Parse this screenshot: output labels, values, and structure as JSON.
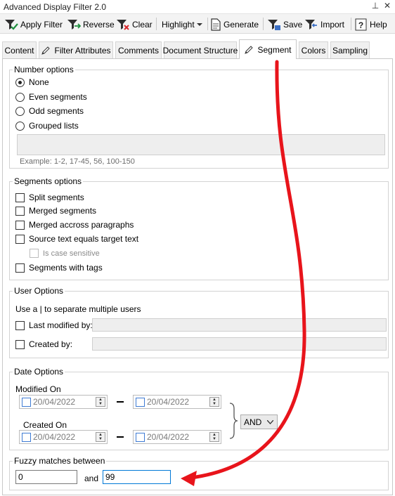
{
  "window": {
    "title": "Advanced Display Filter 2.0",
    "pin_glyph": "⊥",
    "close_glyph": "✕"
  },
  "toolbar": {
    "apply_filter": "Apply Filter",
    "reverse": "Reverse",
    "clear": "Clear",
    "highlight": "Highlight",
    "generate": "Generate",
    "save": "Save",
    "import": "Import",
    "help": "Help"
  },
  "tabs": [
    "Content",
    "Filter Attributes",
    "Comments",
    "Document Structure",
    "Segment",
    "Colors",
    "Sampling"
  ],
  "number_options": {
    "title": "Number options",
    "options": [
      "None",
      "Even segments",
      "Odd segments",
      "Grouped lists"
    ],
    "selected": "None",
    "example": "Example: 1-2, 17-45, 56, 100-150"
  },
  "segments_options": {
    "title": "Segments options",
    "items": [
      "Split segments",
      "Merged segments",
      "Merged accross paragraphs",
      "Source text equals target text",
      "Is case sensitive",
      "Segments with tags"
    ]
  },
  "user_options": {
    "title": "User Options",
    "hint": "Use a | to separate multiple users",
    "last_modified_by": "Last modified by:",
    "created_by": "Created by:"
  },
  "date_options": {
    "title": "Date Options",
    "modified_on": "Modified On",
    "created_on": "Created On",
    "modified_from": "20/04/2022",
    "modified_to": "20/04/2022",
    "created_from": "20/04/2022",
    "created_to": "20/04/2022",
    "operator": "AND"
  },
  "fuzzy": {
    "title": "Fuzzy matches between",
    "from": "0",
    "and_label": "and",
    "to": "99"
  },
  "colors": {
    "arrow": "#e8141b",
    "focus": "#0078d7"
  }
}
